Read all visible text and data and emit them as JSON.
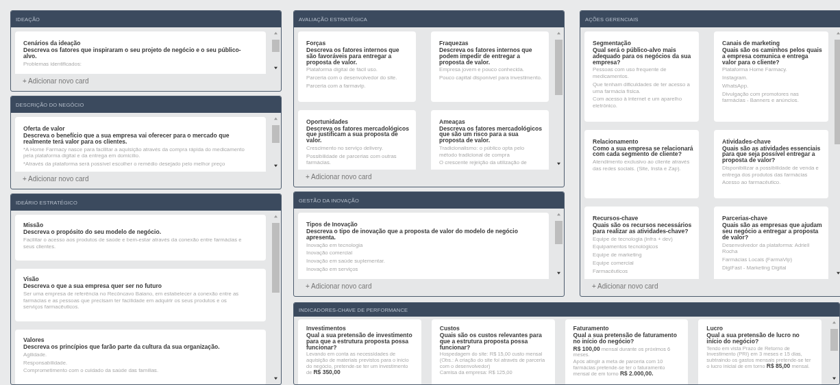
{
  "left_column": [
    {
      "title": "IDEAÇÃO",
      "kind": "list",
      "add_label": "+ Adicionar novo card",
      "cards": [
        {
          "title": "Cenários da ideação",
          "question": "Descreva os fatores que inspiraram o seu projeto de negócio e o seu público-alvo.",
          "lines": [
            "Problemas identificados:"
          ]
        }
      ]
    },
    {
      "title": "DESCRIÇÃO DO NEGÓCIO",
      "kind": "list",
      "add_label": "+ Adicionar novo card",
      "cards": [
        {
          "title": "Oferta de valor",
          "question": "Descreva o benefício que a sua empresa vai oferecer para o mercado que realmente terá valor para os clientes.",
          "lines": [
            "*A Home Farmacy nasce para facilitar a aquisição através da compra rápida do medicamento pela plataforma digital e da entrega em domicílio.",
            "*Através da plataforma será possível escolher o remédio desejado pelo melhor preço"
          ]
        }
      ]
    },
    {
      "title": "IDEÁRIO ESTRATÉGICO",
      "kind": "list",
      "cards": [
        {
          "title": "Missão",
          "question": "Descreva o propósito do seu modelo de negócio.",
          "lines": [
            "Facilitar o acesso aos produtos de saúde e bem-estar através da conexão entre farmácias e seus clientes."
          ]
        },
        {
          "title": "Visão",
          "question": "Descreva o que a sua empresa quer ser no futuro",
          "lines": [
            "Ser uma empresa de referência no Recôncavo Baiano, em estabelecer a conexão entre as farmácias e as pessoas que precisam ter facilidade em adquirir os seus produtos e os serviços farmacêuticos."
          ]
        },
        {
          "title": "Valores",
          "question": "Descreva os princípios que farão parte da cultura da sua organização.",
          "lines": [
            "Agilidade.",
            "Responsabilidade.",
            "Comprometimento com o cuidado da saúde das famílias."
          ]
        }
      ]
    }
  ],
  "middle_column": [
    {
      "title": "AVALIAÇÃO ESTRATÉGICA",
      "kind": "grid",
      "add_label": "+ Adicionar novo card",
      "cards": [
        {
          "title": "Forças",
          "question": "Descreva os fatores internos que são favoráveis para entregar a proposta de valor.",
          "lines": [
            "Plataforma digital de fácil uso.",
            "Parceria com o desenvolvedor do site.",
            "Parceria com a farmavip."
          ]
        },
        {
          "title": "Fraquezas",
          "question": "Descreva os fatores internos que podem impedir de entregar a proposta de valor.",
          "lines": [
            "Empresa jovem e pouco conhecida.",
            "Pouco capital disponível para investimento."
          ]
        },
        {
          "title": "Oportunidades",
          "question": "Descreva os fatores mercadológicos que justificam a sua proposta de valor.",
          "lines": [
            "Crescimento no serviço delivery.",
            "Possibilidade de parcerias com outras farmácias."
          ]
        },
        {
          "title": "Ameaças",
          "question": "Descreva os fatores mercadológicos que são um risco para a sua proposta de valor.",
          "lines": [
            "Tradicionalismo: o público opta pelo método tradicional de compra",
            "O crescente rejeição da utilização de"
          ]
        }
      ]
    },
    {
      "title": "GESTÃO DA INOVAÇÃO",
      "kind": "list",
      "add_label": "+ Adicionar novo card",
      "cards": [
        {
          "title": "Tipos de Inovação",
          "question": "Descreva o tipo de inovação que a proposta de valor do modelo de negócio apresenta.",
          "lines": [
            "Inovação em tecnologia",
            "Inovação comercial",
            "Inovação em saúde suplementar.",
            "Inovação em serviços"
          ]
        }
      ]
    }
  ],
  "right_column": [
    {
      "title": "AÇÕES GERENCIAIS",
      "kind": "grid",
      "add_label": "+ Adicionar novo card",
      "cards": [
        {
          "title": "Segmentação",
          "question": "Qual será o público-alvo mais adequado para os negócios da sua empresa?",
          "lines": [
            "Pessoas com uso frequente de medicamentos.",
            "Que tenham dificuldades de ter acesso a uma farmácia física.",
            "Com acesso à internet e um aparelho eletrônico."
          ]
        },
        {
          "title": "Canais de marketing",
          "question": "Quais são os caminhos pelos quais a empresa comunica e entrega valor para o cliente?",
          "lines": [
            "Plataforma Home Farmacy.",
            "Instagram.",
            "WhatsApp.",
            "Divulgação com promotores nas farmácias - Banners e anúncios."
          ]
        },
        {
          "title": "Relacionamento",
          "question": "Como a sua empresa se relacionará com cada segmento de cliente?",
          "lines": [
            "Atendimento exclusivo ao cliente através das redes sociais. (Site, Insta e Zap)."
          ]
        },
        {
          "title": "Atividades-chave",
          "question": "Quais são as atividades essenciais para que seja possível entregar a proposta de valor?",
          "lines": [
            "Disponibilizar a possibilidade de venda e entrega dos produtos das farmácias",
            "Acesso ao farmacêutico."
          ]
        },
        {
          "title": "Recursos-chave",
          "question": "Quais são os recursos necessários para realizar as atividades-chave?",
          "lines": [
            "Equipe de tecnologia (infra + dev)",
            "Equipamentos tecnológicos",
            "Equipe de marketing",
            "Equipe comercial",
            "Farmacêuticos"
          ]
        },
        {
          "title": "Parcerias-chave",
          "question": "Quais são as empresas que ajudam seu negócio a entregar a proposta de valor?",
          "lines": [
            "Desenvolvedor da plataforma: Adriell Rocha",
            "Farmácias Locais (FarmaVip)",
            "DigiFast - Marketing Digital"
          ]
        }
      ]
    }
  ],
  "bottom_panel": {
    "title": "INDICADORES-CHAVE DE PERFORMANCE",
    "kind": "row",
    "cards": [
      {
        "title": "Investimentos",
        "question": "Qual a sua pretensão de investimento para que a estrutura proposta possa funcionar?",
        "lines": [
          "Levando em conta as necessidades de aquisição de materiais previstos para o início do negócio, pretende-se ter um investimento de **R$ 350,00**"
        ]
      },
      {
        "title": "Custos",
        "question": "Quais são os custos relevantes para que a estrutura proposta possa funcionar?",
        "lines": [
          "Hospedagem do site: R$ 15,00 custo mensal (Obs.: A criação do site foi através de parceria com o desenvolvedor)",
          "Camisa da empresa: R$ 125,00"
        ]
      },
      {
        "title": "Faturamento",
        "question": "Qual a sua pretensão de faturamento no início do negócio?",
        "lines": [
          "**R$ 100,00** mensal durante os próximos 6 meses.",
          "Após atingir a meta de parceria com 10 farmácias pretende-se ter o faturamento mensal de em torno **R$ 2.000,00.**"
        ]
      },
      {
        "title": "Lucro",
        "question": "Qual a sua pretensão de lucro no início do negócio?",
        "lines": [
          "Tendo em vista Prazo de Retorno de Investimento (PRI) em 3 meses e 15 dias, subtraindo os gastos mensais pretende-se ter o lucro inicial de em torno **R$ 85,00** mensal."
        ]
      }
    ]
  }
}
